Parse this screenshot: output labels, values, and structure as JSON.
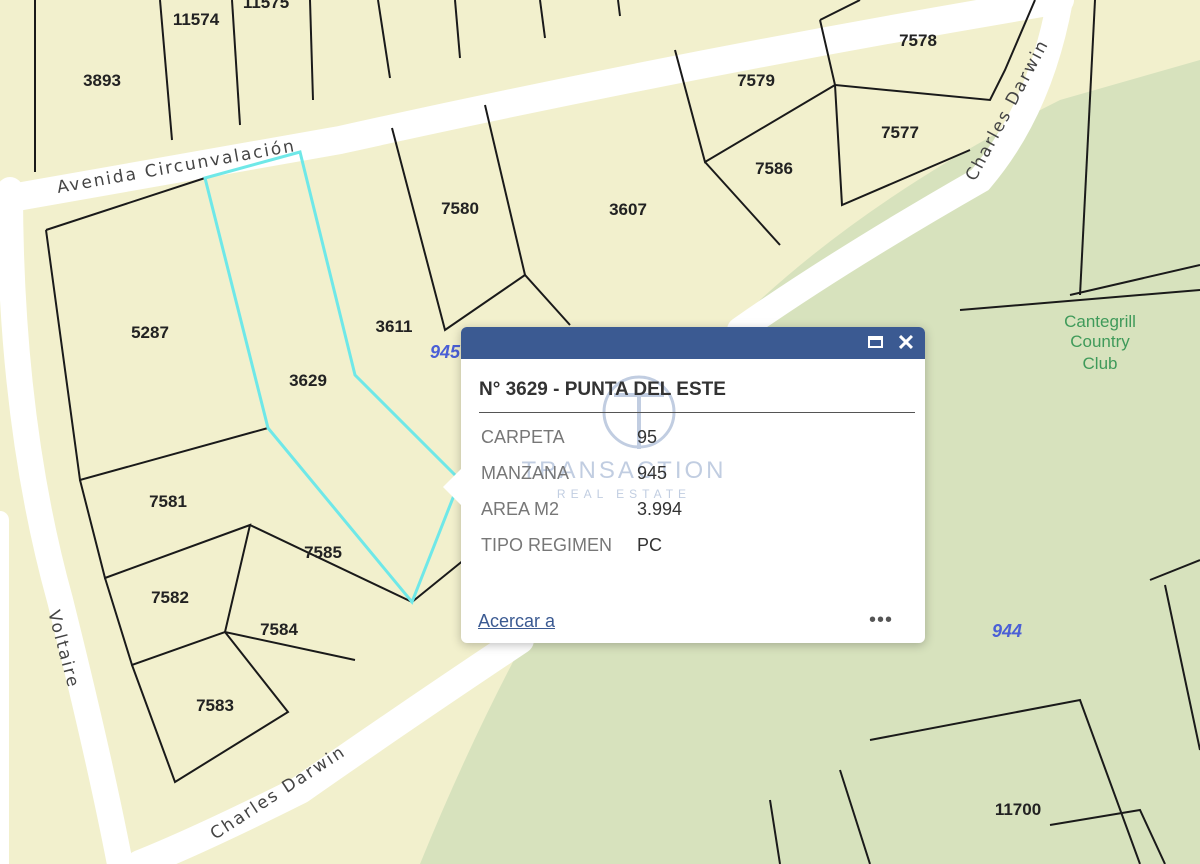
{
  "map": {
    "lots": [
      {
        "id": "11574"
      },
      {
        "id": "11575"
      },
      {
        "id": "3893"
      },
      {
        "id": "7578"
      },
      {
        "id": "7579"
      },
      {
        "id": "7577"
      },
      {
        "id": "7586"
      },
      {
        "id": "7580"
      },
      {
        "id": "3607"
      },
      {
        "id": "5287"
      },
      {
        "id": "3611"
      },
      {
        "id": "3629"
      },
      {
        "id": "7581"
      },
      {
        "id": "7585"
      },
      {
        "id": "7582"
      },
      {
        "id": "7584"
      },
      {
        "id": "7583"
      },
      {
        "id": "11700"
      }
    ],
    "streets": {
      "avenida": "Avenida Circunvalación",
      "darwin_top": "Charles Darwin",
      "darwin_bottom": "Charles Darwin",
      "voltaire": "Voltaire"
    },
    "blocks": {
      "b945": "945",
      "b944": "944"
    },
    "area": {
      "line1": "Cantegrill",
      "line2": "Country",
      "line3": "Club"
    },
    "colors": {
      "parcel_fill": "#f2f0cd",
      "park_fill": "#d7e2bd",
      "road": "#ffffff",
      "highlight": "#6fe8e8",
      "lines": "#1a1a1a"
    }
  },
  "popup": {
    "title": "N° 3629 - PUNTA DEL ESTE",
    "attributes": [
      {
        "key": "CARPETA",
        "value": "95"
      },
      {
        "key": "MANZANA",
        "value": "945"
      },
      {
        "key": "AREA M2",
        "value": "3.994"
      },
      {
        "key": "TIPO REGIMEN",
        "value": "PC"
      }
    ],
    "zoom_link": "Acercar a",
    "more": "•••",
    "close": "✕",
    "header_color": "#3b5a92",
    "watermark": {
      "name": "TRANSACTION",
      "sub": "REAL ESTATE"
    }
  }
}
